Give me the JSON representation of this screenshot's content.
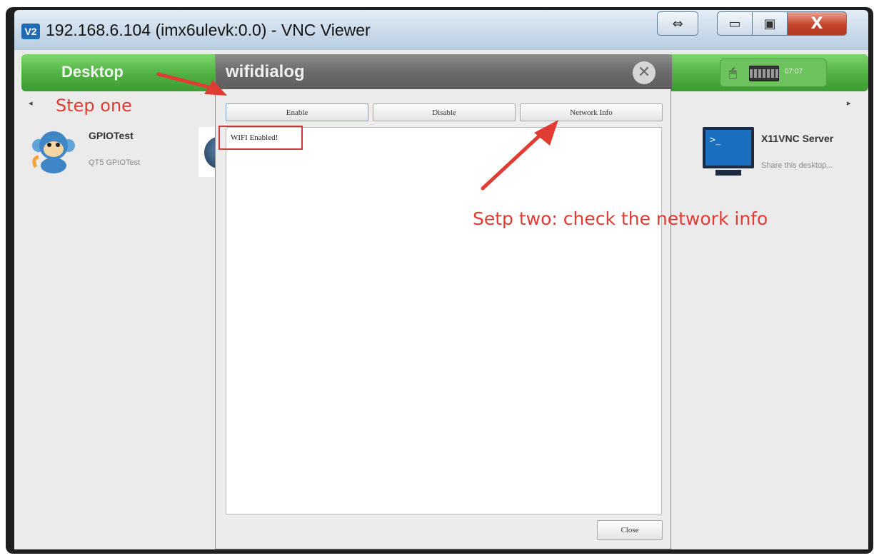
{
  "window": {
    "logo": "V2",
    "title": "192.168.6.104 (imx6ulevk:0.0) - VNC Viewer",
    "controls": {
      "fullscreen_icon": "double-arrow-icon",
      "minimize_icon": "minimize-icon",
      "maximize_icon": "maximize-icon",
      "close_glyph": "X"
    }
  },
  "desktop": {
    "bar_label": "Desktop",
    "tray": {
      "clock": "07:07"
    },
    "apps": [
      {
        "name": "GPIOTest",
        "desc": "QT5 GPIOTest"
      },
      {
        "name": "X11VNC Server",
        "desc": "Share this desktop..."
      }
    ]
  },
  "dialog": {
    "title": "wifidialog",
    "buttons": {
      "enable": "Enable",
      "disable": "Disable",
      "network_info": "Network Info",
      "close": "Close"
    },
    "output": "WIFI Enabled!"
  },
  "annotations": {
    "step_one": "Step one",
    "step_two": "Setp two: check the network info"
  },
  "colors": {
    "annotation": "#e03c34",
    "desktop_bar": "#4fb041",
    "dialog_title": "#6a6a6a"
  }
}
